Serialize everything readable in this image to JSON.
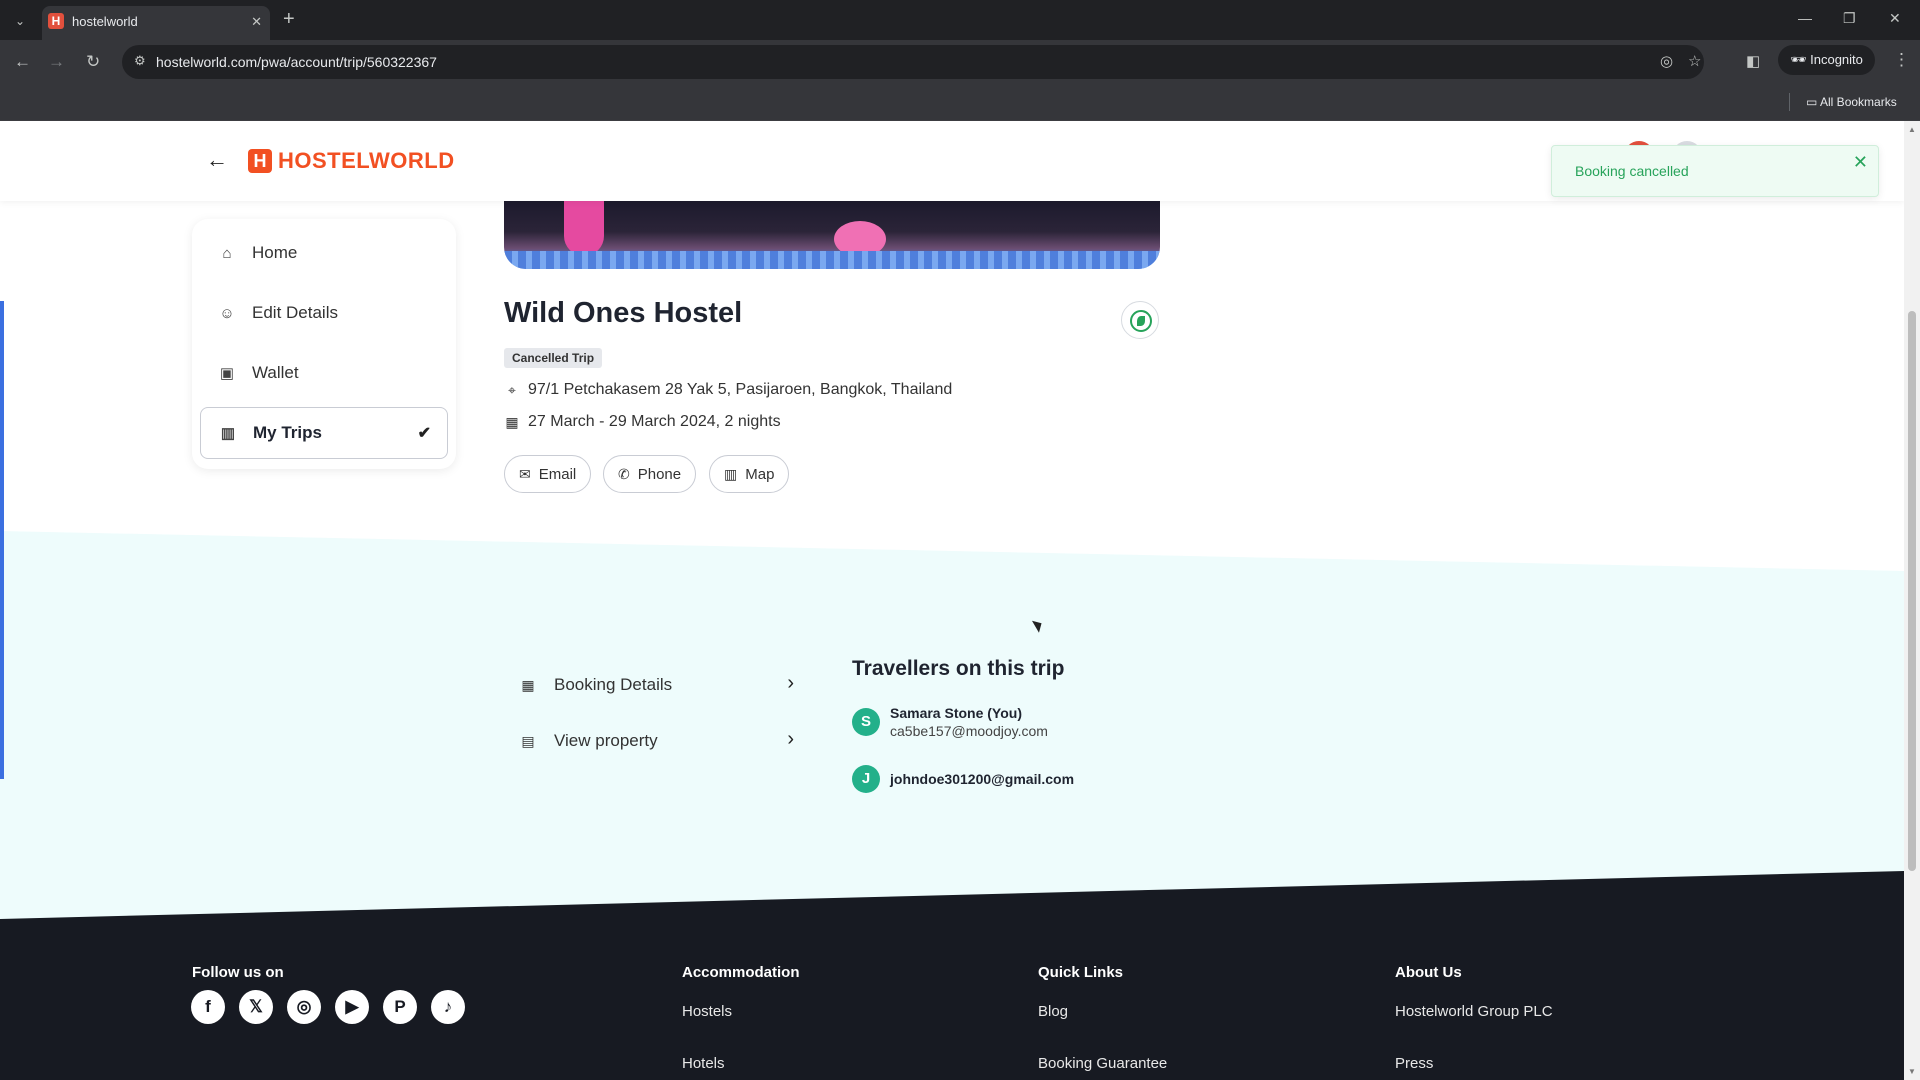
{
  "browser": {
    "tab_title": "hostelworld",
    "tab_favicon": "H",
    "url": "hostelworld.com/pwa/account/trip/560322367",
    "incognito_label": "Incognito",
    "all_bookmarks": "All Bookmarks"
  },
  "header": {
    "logo_mark": "H",
    "logo_text": "HOSTELWORLD"
  },
  "toast": {
    "message": "Booking cancelled",
    "color": "#27a35a"
  },
  "side_nav": {
    "items": [
      {
        "label": "Home",
        "icon": "home-icon"
      },
      {
        "label": "Edit Details",
        "icon": "user-icon"
      },
      {
        "label": "Wallet",
        "icon": "wallet-icon"
      },
      {
        "label": "My Trips",
        "icon": "map-icon",
        "active": true
      }
    ]
  },
  "property": {
    "name": "Wild Ones Hostel",
    "status": "Cancelled Trip",
    "address": "97/1 Petchakasem 28 Yak 5, Pasijaroen, Bangkok, Thailand",
    "dates": "27 March - 29 March 2024, 2 nights",
    "actions": [
      "Email",
      "Phone",
      "Map"
    ]
  },
  "links": [
    {
      "label": "Booking Details",
      "icon": "calendar-icon"
    },
    {
      "label": "View property",
      "icon": "building-icon"
    }
  ],
  "travellers": {
    "title": "Travellers on this trip",
    "list": [
      {
        "initial": "S",
        "name": "Samara Stone (You)",
        "email": "ca5be157@moodjoy.com"
      },
      {
        "initial": "J",
        "name": "johndoe301200@gmail.com",
        "email": ""
      }
    ]
  },
  "footer": {
    "follow_title": "Follow us on",
    "social": [
      "facebook-icon",
      "x-icon",
      "instagram-icon",
      "youtube-icon",
      "pinterest-icon",
      "tiktok-icon"
    ],
    "columns": [
      {
        "title": "Accommodation",
        "links": [
          "Hostels",
          "Hotels"
        ]
      },
      {
        "title": "Quick Links",
        "links": [
          "Blog",
          "Booking Guarantee"
        ]
      },
      {
        "title": "About Us",
        "links": [
          "Hostelworld Group PLC",
          "Press"
        ]
      }
    ]
  },
  "colors": {
    "brand": "#f25022",
    "accent_green": "#23b08a",
    "footer_bg": "#171a22",
    "band_bg": "#eefcfc"
  }
}
